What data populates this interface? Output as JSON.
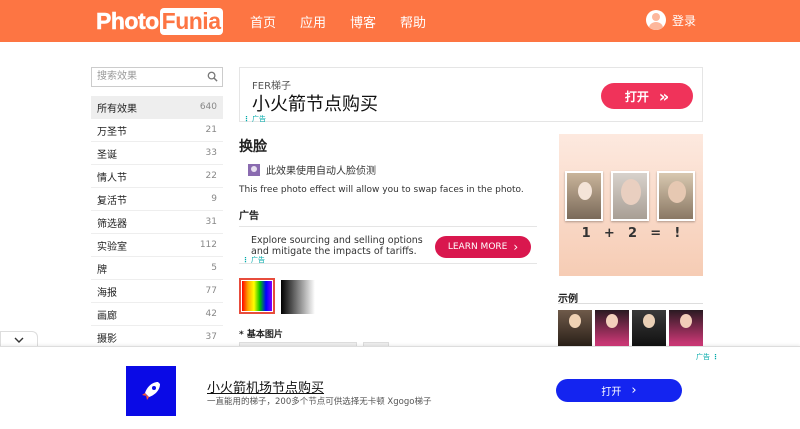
{
  "header": {
    "logo_part1": "Photo",
    "logo_part2": "Funia",
    "nav": [
      "首页",
      "应用",
      "博客",
      "帮助"
    ],
    "login": "登录"
  },
  "sidebar": {
    "search_placeholder": "搜索效果",
    "items": [
      {
        "label": "所有效果",
        "count": "640"
      },
      {
        "label": "万圣节",
        "count": "21"
      },
      {
        "label": "圣诞",
        "count": "33"
      },
      {
        "label": "情人节",
        "count": "22"
      },
      {
        "label": "复活节",
        "count": "9"
      },
      {
        "label": "筛选器",
        "count": "31"
      },
      {
        "label": "实验室",
        "count": "112"
      },
      {
        "label": "牌",
        "count": "5"
      },
      {
        "label": "海报",
        "count": "77"
      },
      {
        "label": "画廊",
        "count": "42"
      },
      {
        "label": "摄影",
        "count": "37"
      }
    ]
  },
  "top_ad": {
    "small": "FER梯子",
    "headline": "小火箭节点购买",
    "button": "打开",
    "button_arrows": "»",
    "tag": "广告"
  },
  "main": {
    "title": "换脸",
    "face_detection": "此效果使用自动人脸侦测",
    "description": "This free photo effect will allow you to swap faces in the photo.",
    "ad_section": "广告",
    "basic_image_label": "* 基本图片"
  },
  "mid_ad": {
    "text": "Explore sourcing and selling options and mitigate the impacts of tariffs.",
    "button": "LEARN MORE",
    "button_arrow": "›",
    "tag": "广告"
  },
  "preview": {
    "equation": [
      "1",
      "+",
      "2",
      "=",
      "!"
    ]
  },
  "examples_label": "示例",
  "bottom_ad": {
    "headline": "小火箭机场节点购买",
    "sub": "一直能用的梯子，200多个节点可供选择无卡顿 Xgogo梯子",
    "button": "打开",
    "button_arrow": "›",
    "tag": "广告"
  },
  "colors": {
    "header": "#fd7543",
    "top_ad_button": "#f0335a",
    "mid_ad_button": "#d9174e",
    "bottom_ad_button": "#1424f0"
  }
}
